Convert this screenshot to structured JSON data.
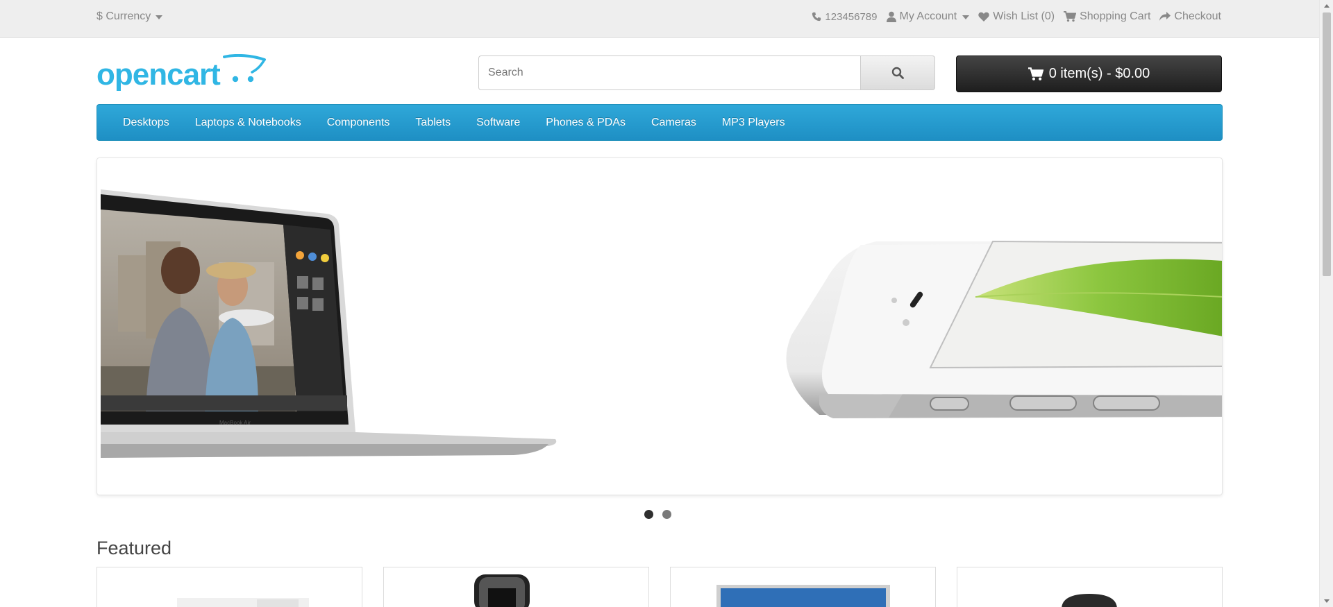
{
  "topbar": {
    "currency_label": "$ Currency",
    "phone": "123456789",
    "my_account": "My Account",
    "wish_list": "Wish List (0)",
    "shopping_cart": "Shopping Cart",
    "checkout": "Checkout"
  },
  "logo": {
    "text": "opencart"
  },
  "search": {
    "placeholder": "Search"
  },
  "cart": {
    "label": "0 item(s) - $0.00"
  },
  "nav": {
    "items": [
      "Desktops",
      "Laptops & Notebooks",
      "Components",
      "Tablets",
      "Software",
      "Phones & PDAs",
      "Cameras",
      "MP3 Players"
    ]
  },
  "slideshow": {
    "slides": 2,
    "active_index": 0,
    "laptop_screen_text": "MacBook Air"
  },
  "featured": {
    "title": "Featured"
  },
  "colors": {
    "brand": "#30b6e4",
    "nav_bg": "#229ac8",
    "cart_bg": "#303030",
    "topbar_bg": "#eeeeee"
  }
}
